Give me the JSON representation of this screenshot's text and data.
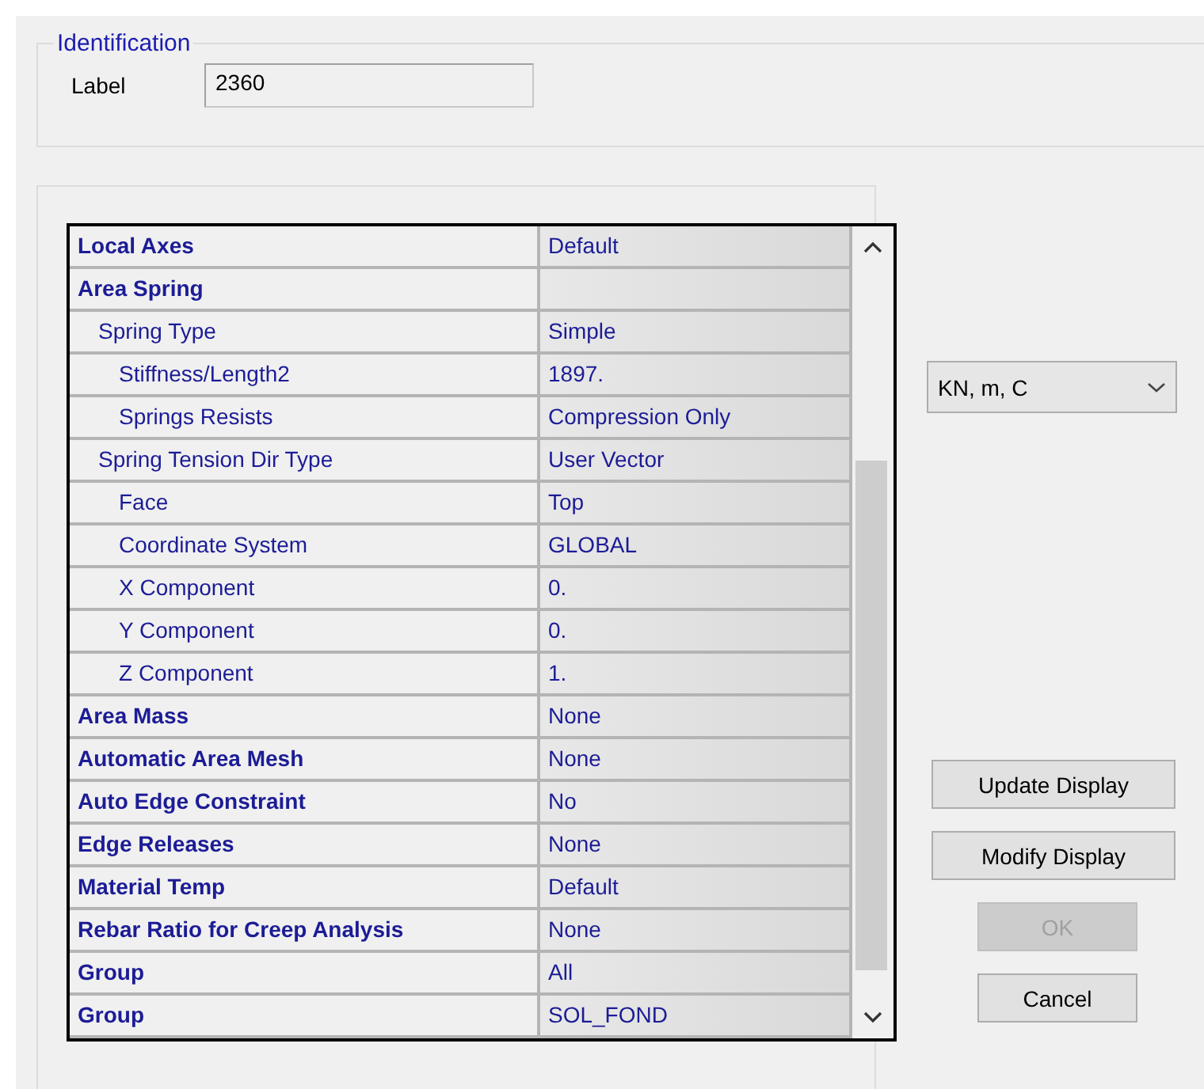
{
  "identification": {
    "title": "Identification",
    "label": "Label",
    "value": "2360"
  },
  "properties": [
    {
      "name": "Local Axes",
      "value": "Default"
    },
    {
      "name": "Area Spring",
      "children": [
        {
          "name": "Spring Type",
          "value": "Simple",
          "children": [
            {
              "name": "Stiffness/Length2",
              "value": "1897."
            },
            {
              "name": "Springs Resists",
              "value": "Compression Only"
            }
          ]
        },
        {
          "name": "Spring Tension Dir Type",
          "value": "User Vector",
          "children": [
            {
              "name": "Face",
              "value": "Top"
            },
            {
              "name": "Coordinate System",
              "value": "GLOBAL"
            },
            {
              "name": "X  Component",
              "value": "0."
            },
            {
              "name": "Y  Component",
              "value": "0."
            },
            {
              "name": "Z  Component",
              "value": "1."
            }
          ]
        }
      ]
    },
    {
      "name": "Area Mass",
      "value": "None"
    },
    {
      "name": "Automatic Area Mesh",
      "value": "None"
    },
    {
      "name": "Auto Edge Constraint",
      "value": "No"
    },
    {
      "name": "Edge Releases",
      "value": "None"
    },
    {
      "name": "Material Temp",
      "value": "Default"
    },
    {
      "name": "Rebar Ratio for Creep Analysis",
      "value": "None"
    },
    {
      "name": "Group",
      "value": "All"
    },
    {
      "name": "Group",
      "value": "SOL_FOND"
    }
  ],
  "units": {
    "value": "KN, m, C"
  },
  "buttons": [
    {
      "label": "Update Display",
      "kind": "wide",
      "disabled": false
    },
    {
      "label": "Modify Display",
      "kind": "wide",
      "disabled": false
    },
    {
      "label": "OK",
      "kind": "narrow",
      "disabled": true
    },
    {
      "label": "Cancel",
      "kind": "narrow",
      "disabled": false
    }
  ]
}
